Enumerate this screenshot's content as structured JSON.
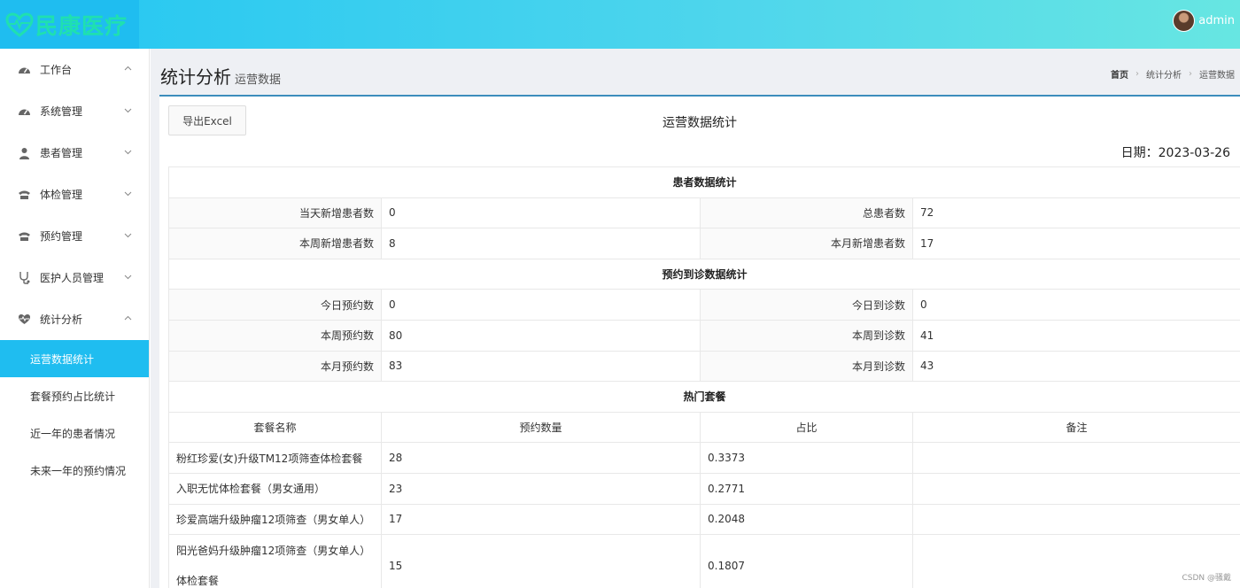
{
  "header": {
    "logo_text": "民康医疗",
    "username": "admin"
  },
  "sidebar": {
    "items": [
      {
        "label": "工作台",
        "icon": "dashboard-icon",
        "chevron": "up"
      },
      {
        "label": "系统管理",
        "icon": "dashboard-icon",
        "chevron": "down"
      },
      {
        "label": "患者管理",
        "icon": "user-icon",
        "chevron": "down"
      },
      {
        "label": "体检管理",
        "icon": "phone-icon",
        "chevron": "down"
      },
      {
        "label": "预约管理",
        "icon": "phone-icon",
        "chevron": "down"
      },
      {
        "label": "医护人员管理",
        "icon": "stethoscope-icon",
        "chevron": "down"
      },
      {
        "label": "统计分析",
        "icon": "heartbeat-icon",
        "chevron": "up"
      }
    ],
    "subitems": [
      {
        "label": "运营数据统计",
        "active": true
      },
      {
        "label": "套餐预约占比统计",
        "active": false
      },
      {
        "label": "近一年的患者情况",
        "active": false
      },
      {
        "label": "未来一年的预约情况",
        "active": false
      }
    ]
  },
  "page": {
    "title": "统计分析",
    "subtitle": "运营数据",
    "breadcrumb": [
      "首页",
      "统计分析",
      "运营数据"
    ]
  },
  "report": {
    "export_label": "导出Excel",
    "title": "运营数据统计",
    "date": "日期：2023-03-26",
    "patient_section": "患者数据统计",
    "patient_rows": [
      {
        "l1": "当天新增患者数",
        "v1": "0",
        "l2": "总患者数",
        "v2": "72"
      },
      {
        "l1": "本周新增患者数",
        "v1": "8",
        "l2": "本月新增患者数",
        "v2": "17"
      }
    ],
    "appointment_section": "预约到诊数据统计",
    "appointment_rows": [
      {
        "l1": "今日预约数",
        "v1": "0",
        "l2": "今日到诊数",
        "v2": "0"
      },
      {
        "l1": "本周预约数",
        "v1": "80",
        "l2": "本周到诊数",
        "v2": "41"
      },
      {
        "l1": "本月预约数",
        "v1": "83",
        "l2": "本月到诊数",
        "v2": "43"
      }
    ],
    "hot_section": "热门套餐",
    "hot_headers": [
      "套餐名称",
      "预约数量",
      "占比",
      "备注"
    ],
    "hot_rows": [
      {
        "name": "粉红珍爱(女)升级TM12项筛查体检套餐",
        "count": "28",
        "ratio": "0.3373",
        "note": ""
      },
      {
        "name": "入职无忧体检套餐（男女通用）",
        "count": "23",
        "ratio": "0.2771",
        "note": ""
      },
      {
        "name": "珍爱高端升级肿瘤12项筛查（男女单人）",
        "count": "17",
        "ratio": "0.2048",
        "note": ""
      },
      {
        "name": "阳光爸妈升级肿瘤12项筛查（男女单人）体检套餐",
        "count": "15",
        "ratio": "0.1807",
        "note": ""
      }
    ]
  },
  "watermark": "CSDN @骚戴",
  "colors": {
    "accent": "#1fbdf0",
    "header_end": "#67e6e2",
    "card_top": "#3c8dbc"
  }
}
